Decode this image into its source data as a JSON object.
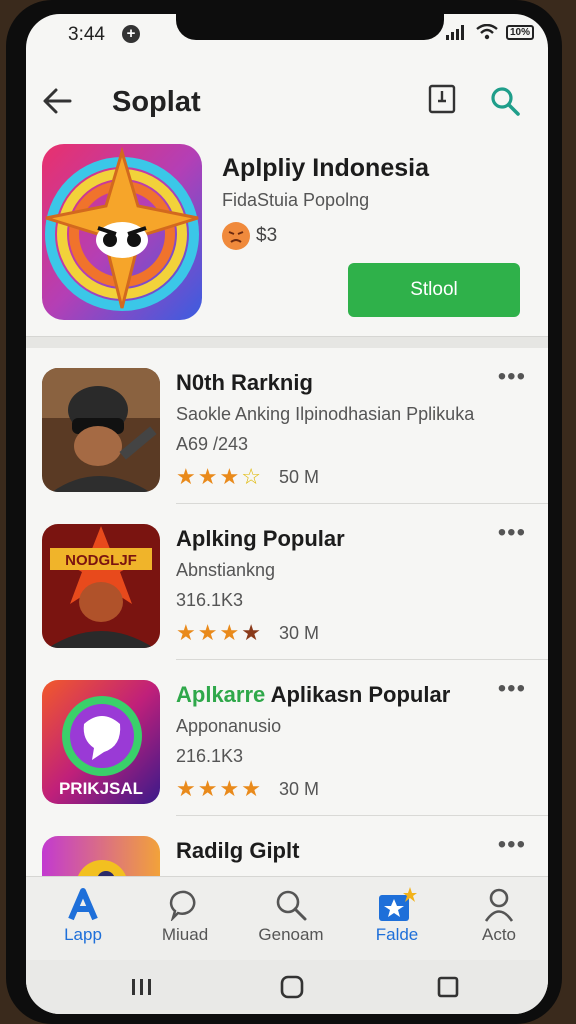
{
  "status": {
    "time": "3:44",
    "plus": "+",
    "battery": "10%"
  },
  "header": {
    "title": "Soplat"
  },
  "hero": {
    "name": "Aplpliy Indonesia",
    "subtitle": "FidaStuia Popolng",
    "rating": "$3",
    "install_label": "Stlool"
  },
  "apps": [
    {
      "name": "N0th Rarknig",
      "subtitle": "Saokle Anking Ilpinodhasian Pplikuka",
      "count": "A69 /243",
      "size": "50 M",
      "rating": 3.5
    },
    {
      "name": "Aplking Popular",
      "subtitle": "Abnstiankng",
      "count": "316.1K3",
      "size": "30 M",
      "rating": 4
    },
    {
      "name_prefix": "Aplkarre",
      "name": " Aplikasn Popular",
      "subtitle": "Apponanusio",
      "count": "216.1K3",
      "size": "30 M",
      "rating": 4,
      "icon_text": "PRIKJSAL"
    },
    {
      "name": "Radilg Giplt",
      "subtitle": "",
      "count": "",
      "size": "",
      "rating": 0
    }
  ],
  "icon_badges": {
    "app2": "NODGLJF"
  },
  "nav": [
    {
      "label": "Lapp",
      "icon": "apps-icon",
      "active": true
    },
    {
      "label": "Miuad",
      "icon": "chat-icon",
      "active": false
    },
    {
      "label": "Genoam",
      "icon": "search-icon",
      "active": false
    },
    {
      "label": "Falde",
      "icon": "star-badge-icon",
      "active": true
    },
    {
      "label": "Acto",
      "icon": "person-icon",
      "active": false
    }
  ],
  "colors": {
    "accent": "#1e6fd9",
    "install": "#2fb14a",
    "star": "#e98a1b"
  }
}
